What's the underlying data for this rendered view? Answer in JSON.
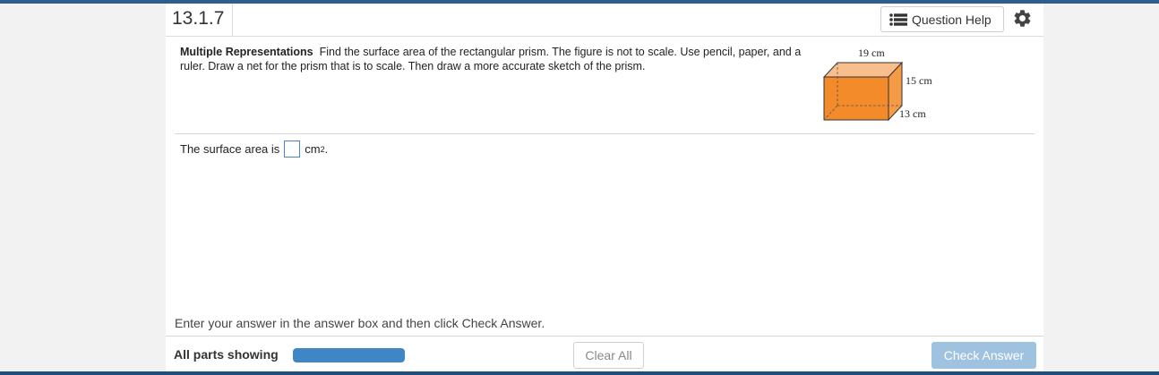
{
  "header": {
    "question_number": "13.1.7",
    "help_label": "Question Help"
  },
  "question": {
    "title": "Multiple Representations",
    "text": "Find the surface area of the rectangular prism. The figure is not to scale. Use pencil, paper, and a ruler. Draw a net for the prism that is to scale. Then draw a more accurate sketch of the prism."
  },
  "figure": {
    "length_label": "19 cm",
    "height_label": "15 cm",
    "depth_label": "13 cm",
    "colors": {
      "front": "#f38b2b",
      "top": "#f8bf8c",
      "side": "#f59a45",
      "edge": "#333333"
    }
  },
  "answer": {
    "prefix": "The surface area is",
    "value": "",
    "unit": "cm",
    "exponent": "2",
    "suffix": "."
  },
  "instruction": "Enter your answer in the answer box and then click Check Answer.",
  "footer": {
    "parts_label": "All parts showing",
    "progress_fraction": 1.0,
    "clear_label": "Clear All",
    "check_label": "Check Answer"
  }
}
